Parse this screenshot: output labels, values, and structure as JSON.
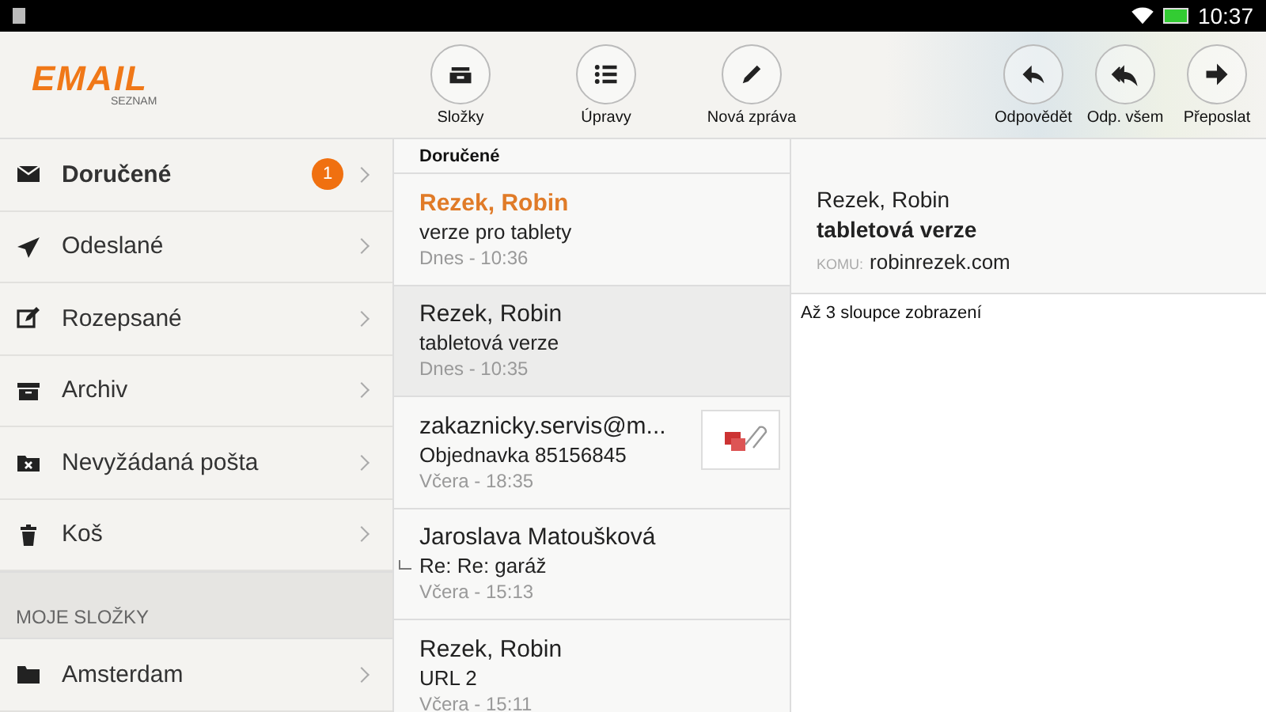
{
  "status_bar": {
    "time": "10:37"
  },
  "toolbar": {
    "logo": {
      "text": "EMAIL",
      "subtext": "SEZNAM"
    },
    "buttons": [
      {
        "kind": "folders",
        "label": "Složky"
      },
      {
        "kind": "edit",
        "label": "Úpravy"
      },
      {
        "kind": "compose",
        "label": "Nová zpráva"
      }
    ],
    "actions": [
      {
        "kind": "reply",
        "label": "Odpovědět"
      },
      {
        "kind": "reply-all",
        "label": "Odp. všem"
      },
      {
        "kind": "forward",
        "label": "Přeposlat"
      }
    ]
  },
  "sidebar": {
    "items": [
      {
        "kind": "inbox",
        "label": "Doručené",
        "badge": "1",
        "selected": true
      },
      {
        "kind": "sent",
        "label": "Odeslané",
        "selected": false
      },
      {
        "kind": "drafts",
        "label": "Rozepsané",
        "selected": false
      },
      {
        "kind": "archive",
        "label": "Archiv",
        "selected": false
      },
      {
        "kind": "spam",
        "label": "Nevyžádaná pošta",
        "selected": false
      },
      {
        "kind": "trash",
        "label": "Koš",
        "selected": false
      }
    ],
    "section": "MOJE SLOŽKY",
    "folders": [
      {
        "kind": "folder",
        "label": "Amsterdam",
        "selected": false
      }
    ]
  },
  "message_list": {
    "title": "Doručené",
    "messages": [
      {
        "sender": "Rezek, Robin",
        "subject": "verze pro tablety",
        "time": "Dnes - 10:36",
        "unread": true,
        "selected": false,
        "attachment": false,
        "replied": false
      },
      {
        "sender": "Rezek, Robin",
        "subject": "tabletová verze",
        "time": "Dnes - 10:35",
        "unread": false,
        "selected": true,
        "attachment": false,
        "replied": false
      },
      {
        "sender": "zakaznicky.servis@m...",
        "subject": "Objednavka 85156845",
        "time": "Včera - 18:35",
        "unread": false,
        "selected": false,
        "attachment": true,
        "replied": false
      },
      {
        "sender": "Jaroslava Matoušková",
        "subject": "Re: Re: garáž",
        "time": "Včera - 15:13",
        "unread": false,
        "selected": false,
        "attachment": false,
        "replied": true
      },
      {
        "sender": "Rezek, Robin",
        "subject": "URL 2",
        "time": "Včera - 15:11",
        "unread": false,
        "selected": false,
        "attachment": false,
        "replied": false
      }
    ]
  },
  "reader": {
    "sender": "Rezek, Robin",
    "subject": "tabletová verze",
    "to_label": "KOMU:",
    "to": "robinrezek.com",
    "body": "Až 3 sloupce zobrazení"
  }
}
